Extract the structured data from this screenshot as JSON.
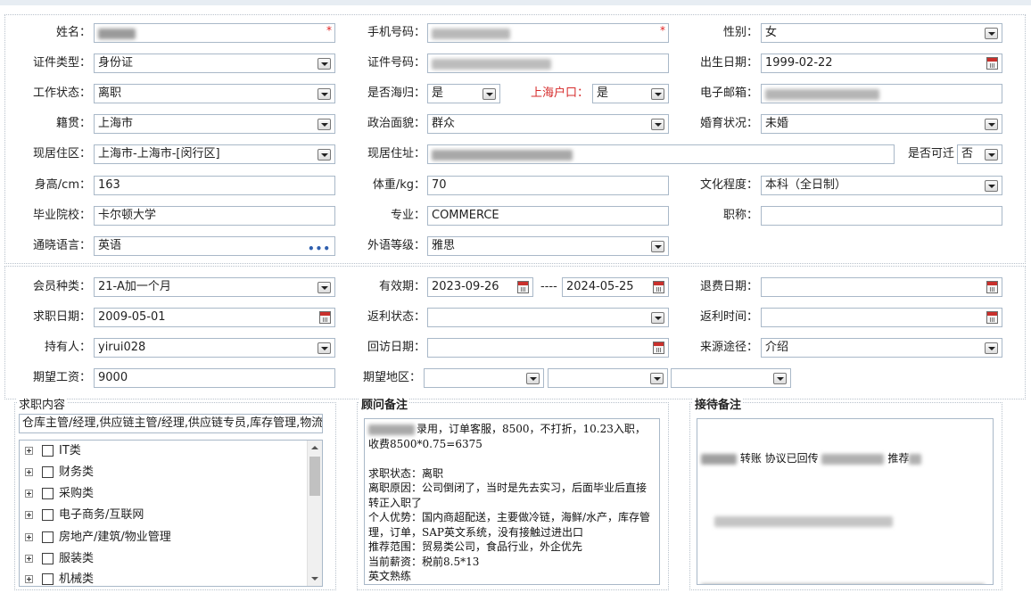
{
  "personal": {
    "name_label": "姓名：",
    "phone_label": "手机号码：",
    "gender_label": "性别：",
    "gender_value": "女",
    "id_type_label": "证件类型：",
    "id_type_value": "身份证",
    "id_no_label": "证件号码：",
    "birth_label": "出生日期：",
    "birth_value": "1999-02-22",
    "work_status_label": "工作状态：",
    "work_status_value": "离职",
    "returnee_label": "是否海归：",
    "returnee_value": "是",
    "sh_hukou_label": "上海户口：",
    "sh_hukou_value": "是",
    "email_label": "电子邮箱：",
    "native_label": "籍贯：",
    "native_value": "上海市",
    "politics_label": "政治面貌：",
    "politics_value": "群众",
    "marital_label": "婚育状况：",
    "marital_value": "未婚",
    "district_label": "现居住区：",
    "district_value": "上海市-上海市-[闵行区]",
    "address_label": "现居住址：",
    "relocate_label": "是否可迁",
    "relocate_value": "否",
    "height_label": "身高/cm：",
    "height_value": "163",
    "weight_label": "体重/kg：",
    "weight_value": "70",
    "education_label": "文化程度：",
    "education_value": "本科（全日制）",
    "school_label": "毕业院校：",
    "school_value": "卡尔顿大学",
    "major_label": "专业：",
    "major_value": "COMMERCE",
    "title_label": "职称：",
    "title_value": "",
    "language_label": "通晓语言：",
    "language_value": "英语",
    "foreign_level_label": "外语等级：",
    "foreign_level_value": "雅思"
  },
  "membership": {
    "type_label": "会员种类：",
    "type_value": "21-A加一个月",
    "valid_label": "有效期：",
    "valid_from": "2023-09-26",
    "valid_sep": "----",
    "valid_to": "2024-05-25",
    "refund_date_label": "退费日期：",
    "job_date_label": "求职日期：",
    "job_date_value": "2009-05-01",
    "rebate_status_label": "返利状态：",
    "rebate_time_label": "返利时间：",
    "holder_label": "持有人：",
    "holder_value": "yirui028",
    "visit_date_label": "回访日期：",
    "source_label": "来源途径：",
    "source_value": "介绍",
    "salary_label": "期望工资：",
    "salary_value": "9000",
    "area_label": "期望地区："
  },
  "job_content": {
    "title": "求职内容",
    "summary": "仓库主管/经理,供应链主管/经理,供应链专员,库存管理,物流",
    "tree": [
      "IT类",
      "财务类",
      "采购类",
      "电子商务/互联网",
      "房地产/建筑/物业管理",
      "服装类",
      "机械类"
    ]
  },
  "advisor_notes": {
    "title": "顾问备注",
    "text": "录用，订单客服，8500，不打折，10.23入职，\n收费8500*0.75=6375\n\n求职状态：离职\n离职原因：公司倒闭了，当时是先去实习，后面毕业后直接转正入职了\n个人优势：国内商超配送，主要做冷链，海鲜/水产，库存管理，订单，SAP英文系统，没有接触过进出口\n推荐范围：贸易类公司，食品行业，外企优先\n当前薪资：税前8.5*13\n英文熟练"
  },
  "reception_notes": {
    "title": "接待备注",
    "fragment1": "转账 协议已回传",
    "fragment2": "推荐"
  },
  "colors": {
    "required": "#e02020",
    "red_label": "#d62b2b",
    "border": "#a9b8c8"
  }
}
